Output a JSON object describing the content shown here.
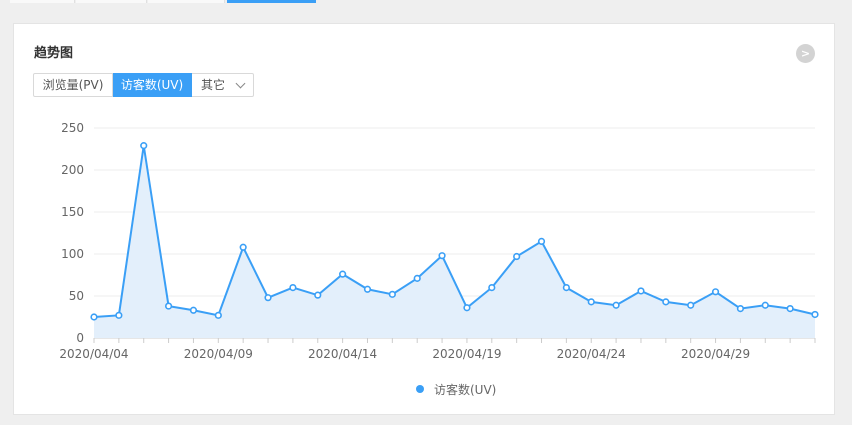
{
  "card": {
    "title": "趋势图"
  },
  "metric_buttons": [
    "浏览量(PV)",
    "访客数(UV)",
    "其它"
  ],
  "colors": {
    "accent": "#3a9ff6",
    "area": "#e3effb",
    "grid": "#ececec"
  },
  "chart_data": {
    "type": "area",
    "title": "",
    "xlabel": "",
    "ylabel": "",
    "ylim": [
      0,
      250
    ],
    "yticks": [
      0,
      50,
      100,
      150,
      200,
      250
    ],
    "grid": true,
    "legend_position": "bottom-center",
    "x": [
      "2020/04/04",
      "2020/04/05",
      "2020/04/06",
      "2020/04/07",
      "2020/04/08",
      "2020/04/09",
      "2020/04/10",
      "2020/04/11",
      "2020/04/12",
      "2020/04/13",
      "2020/04/14",
      "2020/04/15",
      "2020/04/16",
      "2020/04/17",
      "2020/04/18",
      "2020/04/19",
      "2020/04/20",
      "2020/04/21",
      "2020/04/22",
      "2020/04/23",
      "2020/04/24",
      "2020/04/25",
      "2020/04/26",
      "2020/04/27",
      "2020/04/28",
      "2020/04/29",
      "2020/04/30",
      "2020/05/01",
      "2020/05/02",
      "2020/05/03"
    ],
    "xtick_labels": [
      "2020/04/04",
      "2020/04/09",
      "2020/04/14",
      "2020/04/19",
      "2020/04/24",
      "2020/04/29"
    ],
    "series": [
      {
        "name": "访客数(UV)",
        "values": [
          25,
          27,
          229,
          38,
          33,
          27,
          108,
          48,
          60,
          51,
          76,
          58,
          52,
          71,
          98,
          36,
          60,
          97,
          115,
          60,
          43,
          39,
          56,
          43,
          39,
          55,
          35,
          39,
          35,
          28
        ]
      }
    ]
  }
}
